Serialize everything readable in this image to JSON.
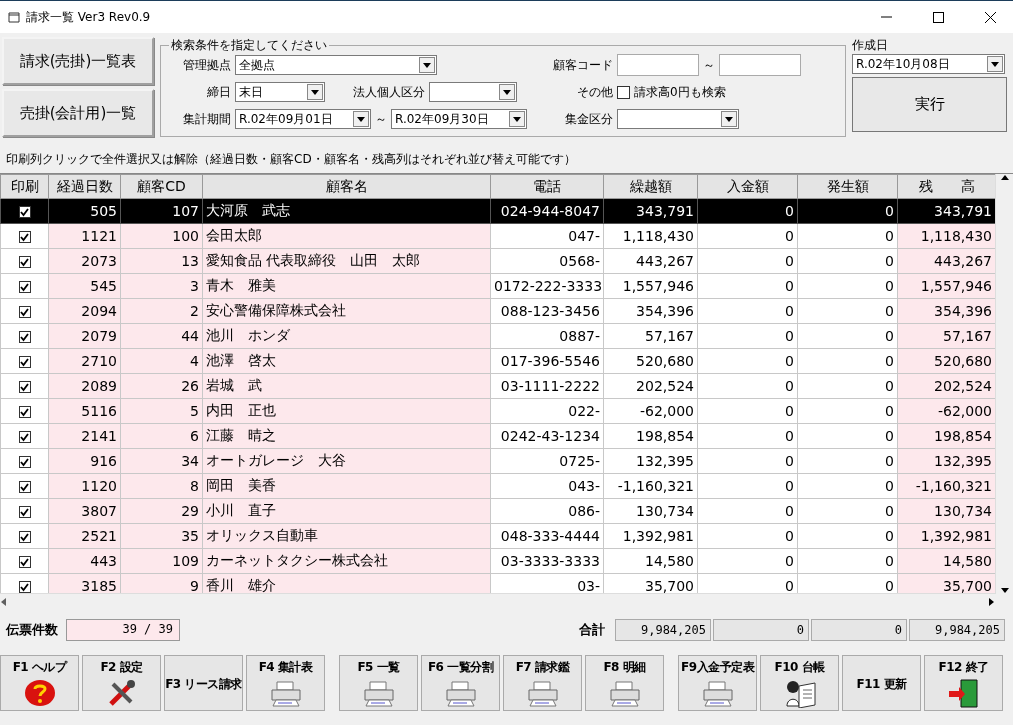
{
  "window": {
    "title": "請求一覧 Ver3 Rev0.9"
  },
  "side_buttons": [
    "請求(売掛)一覧表",
    "売掛(会計用)一覧"
  ],
  "search": {
    "legend": "検索条件を指定してください",
    "base": {
      "label": "管理拠点",
      "value": "全拠点"
    },
    "closing": {
      "label": "締日",
      "value": "末日"
    },
    "corp": {
      "label": "法人個人区分"
    },
    "period": {
      "label": "集計期間",
      "from": "R.02年09月01日",
      "tilde": "～",
      "to": "R.02年09月30日"
    },
    "customer_code": {
      "label": "顧客コード",
      "tilde": "～"
    },
    "other": {
      "label": "その他",
      "checkbox_label": "請求高0円も検索",
      "checked": false
    },
    "collection": {
      "label": "集金区分"
    }
  },
  "created": {
    "label": "作成日",
    "value": "R.02年10月08日"
  },
  "run_button": "実行",
  "hint": "印刷列クリックで全件選択又は解除（経過日数・顧客CD・顧客名・残高列はそれぞれ並び替え可能です）",
  "table": {
    "columns": [
      "印刷",
      "経過日数",
      "顧客CD",
      "顧客名",
      "電話",
      "繰越額",
      "入金額",
      "発生額",
      "残　　高"
    ],
    "rows": [
      {
        "checked": true,
        "selected": true,
        "cells": [
          "",
          "505",
          "107",
          "大河原　武志",
          "024-944-8047",
          "343,791",
          "0",
          "0",
          "343,791"
        ]
      },
      {
        "checked": true,
        "selected": false,
        "cells": [
          "",
          "1121",
          "100",
          "会田太郎",
          "047-",
          "1,118,430",
          "0",
          "0",
          "1,118,430"
        ]
      },
      {
        "checked": true,
        "selected": false,
        "cells": [
          "",
          "2073",
          "13",
          "愛知食品 代表取締役　山田　太郎",
          "0568-",
          "443,267",
          "0",
          "0",
          "443,267"
        ]
      },
      {
        "checked": true,
        "selected": false,
        "cells": [
          "",
          "545",
          "3",
          "青木　雅美",
          "0172-222-3333",
          "1,557,946",
          "0",
          "0",
          "1,557,946"
        ]
      },
      {
        "checked": true,
        "selected": false,
        "cells": [
          "",
          "2094",
          "2",
          "安心警備保障株式会社",
          "088-123-3456",
          "354,396",
          "0",
          "0",
          "354,396"
        ]
      },
      {
        "checked": true,
        "selected": false,
        "cells": [
          "",
          "2079",
          "44",
          "池川　ホンダ",
          "0887-",
          "57,167",
          "0",
          "0",
          "57,167"
        ]
      },
      {
        "checked": true,
        "selected": false,
        "cells": [
          "",
          "2710",
          "4",
          "池澤　啓太",
          "017-396-5546",
          "520,680",
          "0",
          "0",
          "520,680"
        ]
      },
      {
        "checked": true,
        "selected": false,
        "cells": [
          "",
          "2089",
          "26",
          "岩城　武",
          "03-1111-2222",
          "202,524",
          "0",
          "0",
          "202,524"
        ]
      },
      {
        "checked": true,
        "selected": false,
        "cells": [
          "",
          "5116",
          "5",
          "内田　正也",
          "022-",
          "-62,000",
          "0",
          "0",
          "-62,000"
        ]
      },
      {
        "checked": true,
        "selected": false,
        "cells": [
          "",
          "2141",
          "6",
          "江藤　晴之",
          "0242-43-1234",
          "198,854",
          "0",
          "0",
          "198,854"
        ]
      },
      {
        "checked": true,
        "selected": false,
        "cells": [
          "",
          "916",
          "34",
          "オートガレージ　大谷",
          "0725-",
          "132,395",
          "0",
          "0",
          "132,395"
        ]
      },
      {
        "checked": true,
        "selected": false,
        "cells": [
          "",
          "1120",
          "8",
          "岡田　美香",
          "043-",
          "-1,160,321",
          "0",
          "0",
          "-1,160,321"
        ]
      },
      {
        "checked": true,
        "selected": false,
        "cells": [
          "",
          "3807",
          "29",
          "小川　直子",
          "086-",
          "130,734",
          "0",
          "0",
          "130,734"
        ]
      },
      {
        "checked": true,
        "selected": false,
        "cells": [
          "",
          "2521",
          "35",
          "オリックス自動車",
          "048-333-4444",
          "1,392,981",
          "0",
          "0",
          "1,392,981"
        ]
      },
      {
        "checked": true,
        "selected": false,
        "cells": [
          "",
          "443",
          "109",
          "カーネットタクシー株式会社",
          "03-3333-3333",
          "14,580",
          "0",
          "0",
          "14,580"
        ]
      },
      {
        "checked": true,
        "selected": false,
        "cells": [
          "",
          "3185",
          "9",
          "香川　雄介",
          "03-",
          "35,700",
          "0",
          "0",
          "35,700"
        ]
      }
    ]
  },
  "footer": {
    "count_label": "伝票件数",
    "count": "39 / 39",
    "total_label": "合計",
    "totals": [
      "9,984,205",
      "0",
      "0",
      "9,984,205"
    ]
  },
  "function_keys": [
    [
      {
        "label": "F1 ヘルプ",
        "kind": "help"
      },
      {
        "label": "F2 設定",
        "kind": "tools"
      },
      {
        "label": "F3 リース請求",
        "kind": "plain"
      },
      {
        "label": "F4 集計表",
        "kind": "printer"
      }
    ],
    [
      {
        "label": "F5 一覧",
        "kind": "printer"
      },
      {
        "label": "F6 一覧分割",
        "kind": "printer"
      },
      {
        "label": "F7 請求鑑",
        "kind": "printer"
      },
      {
        "label": "F8 明細",
        "kind": "printer"
      }
    ],
    [
      {
        "label": "F9入金予定表",
        "kind": "printer"
      },
      {
        "label": "F10 台帳",
        "kind": "book"
      },
      {
        "label": "F11 更新",
        "kind": "plain"
      },
      {
        "label": "F12 終了",
        "kind": "exit"
      }
    ]
  ]
}
